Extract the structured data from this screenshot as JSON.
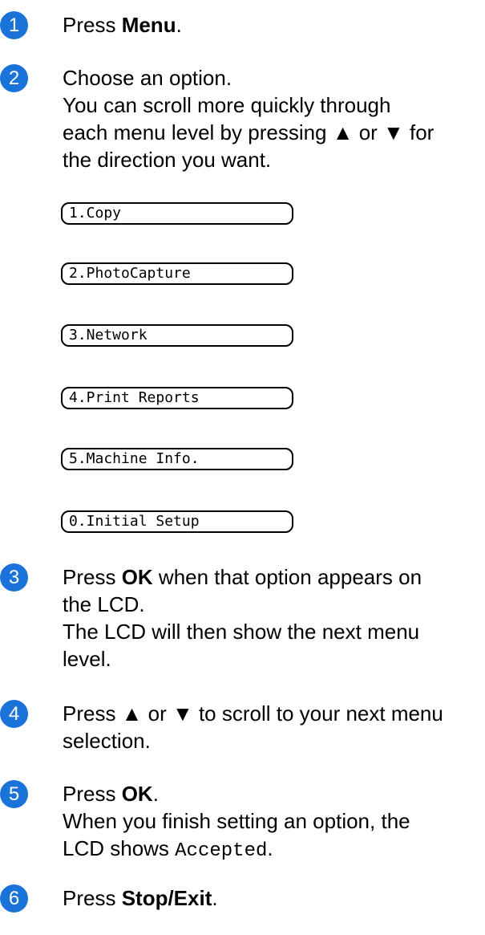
{
  "steps": [
    {
      "number": "1",
      "pre": "Press ",
      "bold": "Menu",
      "post": "."
    },
    {
      "number": "2",
      "lines": [
        "Choose an option.",
        "You can scroll more quickly through",
        "each menu level by pressing ▲ or ▼ for",
        "the direction you want."
      ]
    },
    {
      "number": "3",
      "pre": "Press ",
      "bold": "OK",
      "post": " when that option appears on",
      "lines": [
        "the LCD.",
        "The LCD will then show the next menu",
        "level."
      ]
    },
    {
      "number": "4",
      "lines": [
        "Press ▲ or ▼ to scroll to your next menu",
        "selection."
      ]
    },
    {
      "number": "5",
      "pre": "Press ",
      "bold": "OK",
      "post": ".",
      "lines": [
        "When you finish setting an option, the"
      ],
      "lcd_pre": "LCD shows ",
      "lcd_mono": "Accepted",
      "lcd_post": "."
    },
    {
      "number": "6",
      "pre": "Press ",
      "bold": "Stop/Exit",
      "post": "."
    }
  ],
  "menu_options": [
    "1.Copy",
    "2.PhotoCapture",
    "3.Network",
    "4.Print Reports",
    "5.Machine Info.",
    "0.Initial Setup"
  ],
  "colors": {
    "badge": "#1a73d9"
  }
}
